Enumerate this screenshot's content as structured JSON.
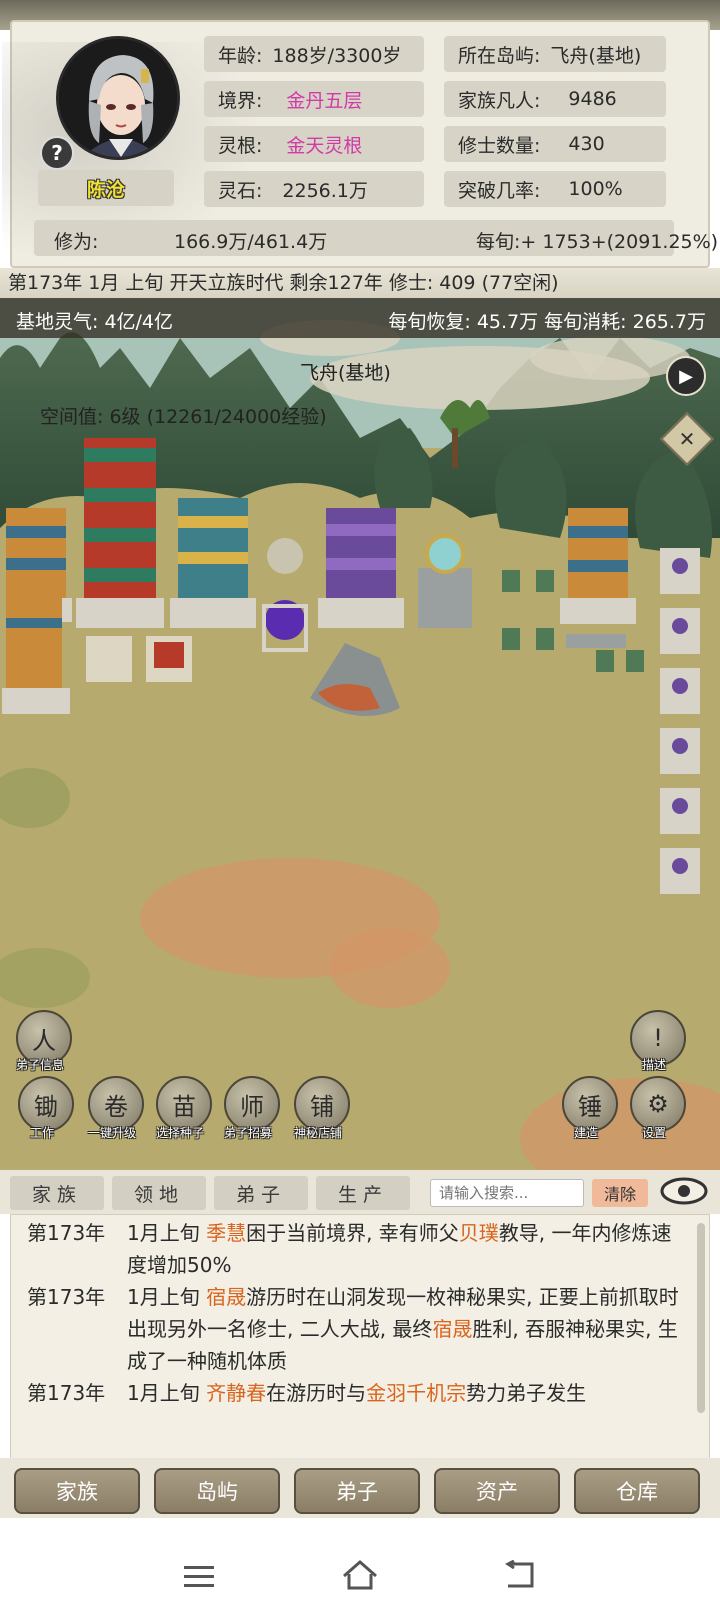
{
  "character": {
    "name": "陈沧",
    "help_icon": "?",
    "age_label": "年龄:",
    "age_value": "188岁/3300岁",
    "realm_label": "境界:",
    "realm_value": "金丹五层",
    "root_label": "灵根:",
    "root_value": "金天灵根",
    "stone_label": "灵石:",
    "stone_value": "2256.1万",
    "island_label": "所在岛屿:",
    "island_value": "飞舟(基地)",
    "mortals_label": "家族凡人:",
    "mortals_value": "9486",
    "cultivators_label": "修士数量:",
    "cultivators_value": "430",
    "breakthrough_label": "突破几率:",
    "breakthrough_value": "100%",
    "cultivation_label": "修为:",
    "cultivation_value": "166.9万/461.4万",
    "per_period_label": "每旬:",
    "per_period_value": "+ 1753+(2091.25%)"
  },
  "status_line": "第173年 1月 上旬  开天立族时代 剩余127年  修士: 409 (77空闲)",
  "map": {
    "spirit_label": "基地灵气: 4亿/4亿",
    "recovery_label": "每旬恢复: 45.7万 每旬消耗: 265.7万",
    "title": "飞舟(基地)",
    "space_level": "空间值: 6级 (12261/24000经验)",
    "play_icon": "▶",
    "close_icon": "✕",
    "tools_left_top": [
      {
        "name": "disciple-info",
        "label": "弟子信息",
        "glyph": "人"
      }
    ],
    "tools_left_bottom": [
      {
        "name": "work",
        "label": "工作",
        "glyph": "锄"
      },
      {
        "name": "one-click-upgrade",
        "label": "一键升级",
        "glyph": "卷"
      },
      {
        "name": "choose-seed",
        "label": "选择种子",
        "glyph": "苗"
      },
      {
        "name": "recruit-disciple",
        "label": "弟子招募",
        "glyph": "师"
      },
      {
        "name": "mystery-shop",
        "label": "神秘店铺",
        "glyph": "铺"
      }
    ],
    "tools_right": [
      {
        "name": "describe",
        "label": "描述",
        "glyph": "!"
      },
      {
        "name": "build",
        "label": "建造",
        "glyph": "锤"
      },
      {
        "name": "settings",
        "label": "设置",
        "glyph": "⚙"
      }
    ]
  },
  "tabs": [
    "家族",
    "领地",
    "弟子",
    "生产"
  ],
  "search": {
    "placeholder": "请输入搜索...",
    "clear_label": "清除"
  },
  "log": [
    {
      "year": "第173年",
      "parts": [
        {
          "t": "1月上旬 "
        },
        {
          "t": "季慧",
          "hl": true
        },
        {
          "t": "困于当前境界, 幸有师父"
        },
        {
          "t": "贝璞",
          "hl": true
        },
        {
          "t": "教导, 一年内修炼速度增加50%"
        }
      ]
    },
    {
      "year": "第173年",
      "parts": [
        {
          "t": "1月上旬 "
        },
        {
          "t": "宿晟",
          "hl": true
        },
        {
          "t": "游历时在山洞发现一枚神秘果实, 正要上前抓取时出现另外一名修士, 二人大战, 最终"
        },
        {
          "t": "宿晟",
          "hl": true
        },
        {
          "t": "胜利, 吞服神秘果实, 生成了一种随机体质"
        }
      ]
    },
    {
      "year": "第173年",
      "parts": [
        {
          "t": "1月上旬 "
        },
        {
          "t": "齐静春",
          "hl": true
        },
        {
          "t": "在游历时与"
        },
        {
          "t": "金羽千机宗",
          "hl": true
        },
        {
          "t": "势力弟子发生"
        }
      ]
    }
  ],
  "bottom_nav": [
    "家族",
    "岛屿",
    "弟子",
    "资产",
    "仓库"
  ],
  "colors": {
    "highlight": "#d9641e",
    "realm": "#d23aa8",
    "name": "#f0e03a"
  }
}
